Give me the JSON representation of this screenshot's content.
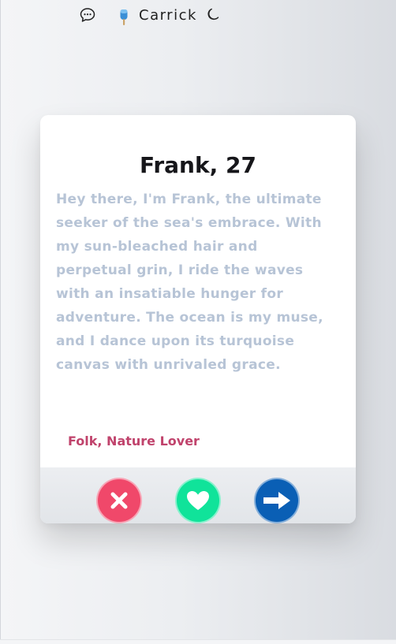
{
  "topbar": {
    "chat_icon": "chat-bubble-icon",
    "logo_icon": "popsicle-icon",
    "brand": "Carrick",
    "theme_icon": "moon-icon"
  },
  "profile": {
    "name_age": "Frank, 27",
    "bio": "Hey there, I'm Frank, the ultimate seeker of the sea's embrace. With my sun-bleached hair and perpetual grin, I ride the waves with an insatiable hunger for adventure. The ocean is my muse, and I dance upon its turquoise canvas with unrivaled grace.",
    "tags": "Folk, Nature Lover"
  },
  "actions": {
    "reject_icon": "x-icon",
    "like_icon": "heart-icon",
    "next_icon": "arrow-right-icon"
  },
  "colors": {
    "reject": "#f0486a",
    "like": "#10e39a",
    "next": "#0a5fb5",
    "tags": "#c0436c",
    "bio": "#b7c4d6"
  }
}
